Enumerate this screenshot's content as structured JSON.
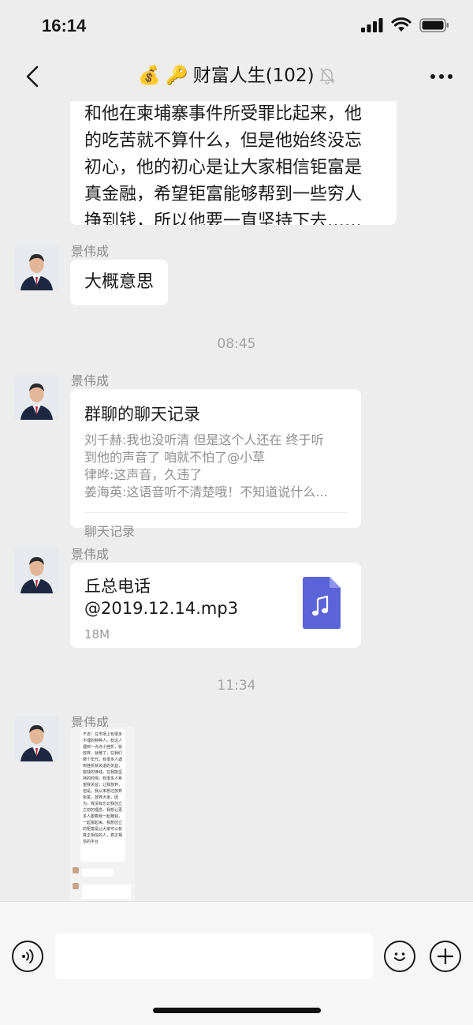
{
  "status_bar": {
    "time": "16:14",
    "icons": [
      "signal-icon",
      "wifi-icon",
      "battery-icon"
    ]
  },
  "nav": {
    "back_icon": "chevron-left-icon",
    "title_emoji_1": "💰",
    "title_emoji_2": "🔑",
    "title": "财富人生(102)",
    "mute_icon": "bell-off-icon",
    "more_icon": "more-icon"
  },
  "messages": {
    "m0": {
      "lines": [
        "和他在柬埔寨事件所受罪比起来，他",
        "的吃苦就不算什么，但是他始终没忘",
        "初心，他的初心是让大家相信钜富是",
        "真金融，希望钜富能够帮到一些穷人",
        "挣到钱，所以他要一直坚持下去……"
      ]
    },
    "m1": {
      "sender": "景伟成",
      "text": "大概意思"
    },
    "ts1": "08:45",
    "m2": {
      "sender": "景伟成",
      "title": "群聊的聊天记录",
      "lines": [
        "刘千赫:我也没听清  但是这个人还在  终于听",
        "到他的声音了 咱就不怕了@小草",
        "律晔:这声音，久违了",
        "姜海英:这语音听不清楚哦！不知道说什么..."
      ],
      "footer": "聊天记录"
    },
    "m3": {
      "sender": "景伟成",
      "file_name_1": "丘总电话",
      "file_name_2": "@2019.12.14.mp3",
      "file_size": "18M",
      "file_icon": "music-file-icon"
    },
    "ts2": "11:34",
    "m4": {
      "sender": "景伟成",
      "screenshot_text": "不去）在市场上有很多不理的种种人，有这人遇到一点点小挫折，就放弃，就散了，在我们那个年代，有很多人遇到挫折就关退的关益，能钱的挣钱，在我能坚持的时候，有很多人希望我关益，让我放弃，但是，我从未想过放弃钜富，放弃大家，因为，我没有忘记我创立之初的理念，我想让更多人跟着我一起赚钱，一起富起来。我想创立的钜富是让大家可以有真正相信的人，真正相信的平台"
    }
  },
  "input_bar": {
    "voice_icon": "voice-icon",
    "emoji_icon": "emoji-icon",
    "plus_icon": "plus-icon"
  },
  "colors": {
    "background": "#ededed",
    "bubble": "#ffffff",
    "file_icon": "#5b63d8"
  }
}
